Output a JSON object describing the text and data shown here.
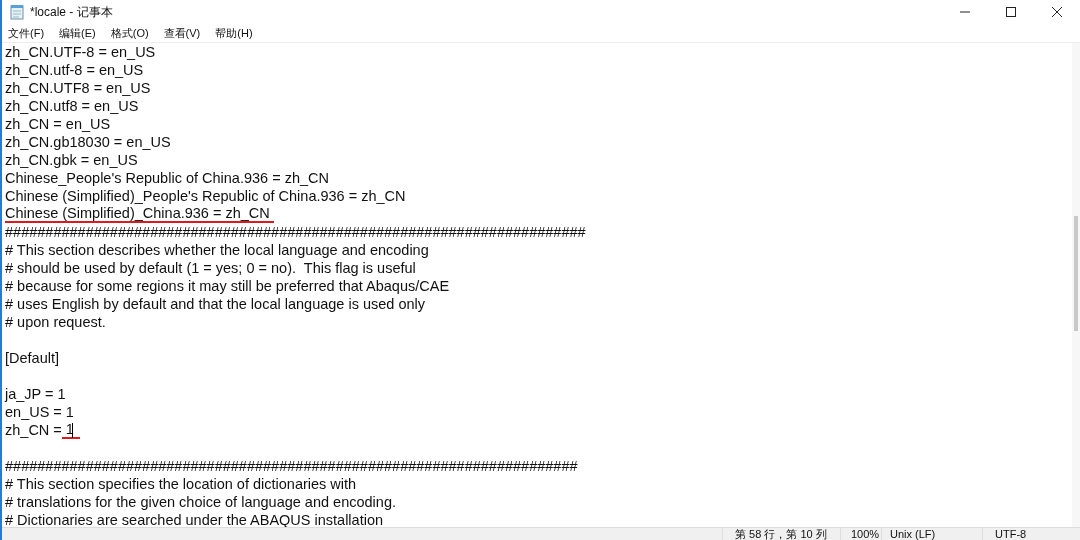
{
  "window": {
    "title": "*locale - 记事本"
  },
  "menu": [
    "文件(F)",
    "编辑(E)",
    "格式(O)",
    "查看(V)",
    "帮助(H)"
  ],
  "lines": [
    {
      "kind": "text",
      "text": "zh_CN.UTF-8 = en_US"
    },
    {
      "kind": "text",
      "text": "zh_CN.utf-8 = en_US"
    },
    {
      "kind": "text",
      "text": "zh_CN.UTF8 = en_US"
    },
    {
      "kind": "text",
      "text": "zh_CN.utf8 = en_US"
    },
    {
      "kind": "text",
      "text": "zh_CN = en_US"
    },
    {
      "kind": "text",
      "text": "zh_CN.gb18030 = en_US"
    },
    {
      "kind": "text",
      "text": "zh_CN.gbk = en_US"
    },
    {
      "kind": "text",
      "text": "Chinese_People's Republic of China.936 = zh_CN"
    },
    {
      "kind": "text",
      "text": "Chinese (Simplified)_People's Republic of China.936 = zh_CN"
    },
    {
      "kind": "underlined",
      "text": "Chinese (Simplified)_China.936 = zh_CN"
    },
    {
      "kind": "text",
      "text": "########################################################################"
    },
    {
      "kind": "text",
      "text": "# This section describes whether the local language and encoding"
    },
    {
      "kind": "text",
      "text": "# should be used by default (1 = yes; 0 = no).  This flag is useful"
    },
    {
      "kind": "text",
      "text": "# because for some regions it may still be preferred that Abaqus/CAE"
    },
    {
      "kind": "text",
      "text": "# uses English by default and that the local language is used only"
    },
    {
      "kind": "text",
      "text": "# upon request."
    },
    {
      "kind": "blank"
    },
    {
      "kind": "text",
      "text": "[Default]"
    },
    {
      "kind": "blank"
    },
    {
      "kind": "text",
      "text": "ja_JP = 1"
    },
    {
      "kind": "text",
      "text": "en_US = 1"
    },
    {
      "kind": "tail_underlined",
      "text": "zh_CN =",
      "tail": " 1",
      "caret": true
    },
    {
      "kind": "blank"
    },
    {
      "kind": "text",
      "text": "#######################################################################"
    },
    {
      "kind": "text",
      "text": "# This section specifies the location of dictionaries with"
    },
    {
      "kind": "text",
      "text": "# translations for the given choice of language and encoding."
    },
    {
      "kind": "text",
      "text": "# Dictionaries are searched under the ABAQUS installation"
    }
  ],
  "status_bar": {
    "position": "第 58 行，第 10 列",
    "zoom": "100%",
    "line_ending": "Unix (LF)",
    "encoding": "UTF-8"
  }
}
